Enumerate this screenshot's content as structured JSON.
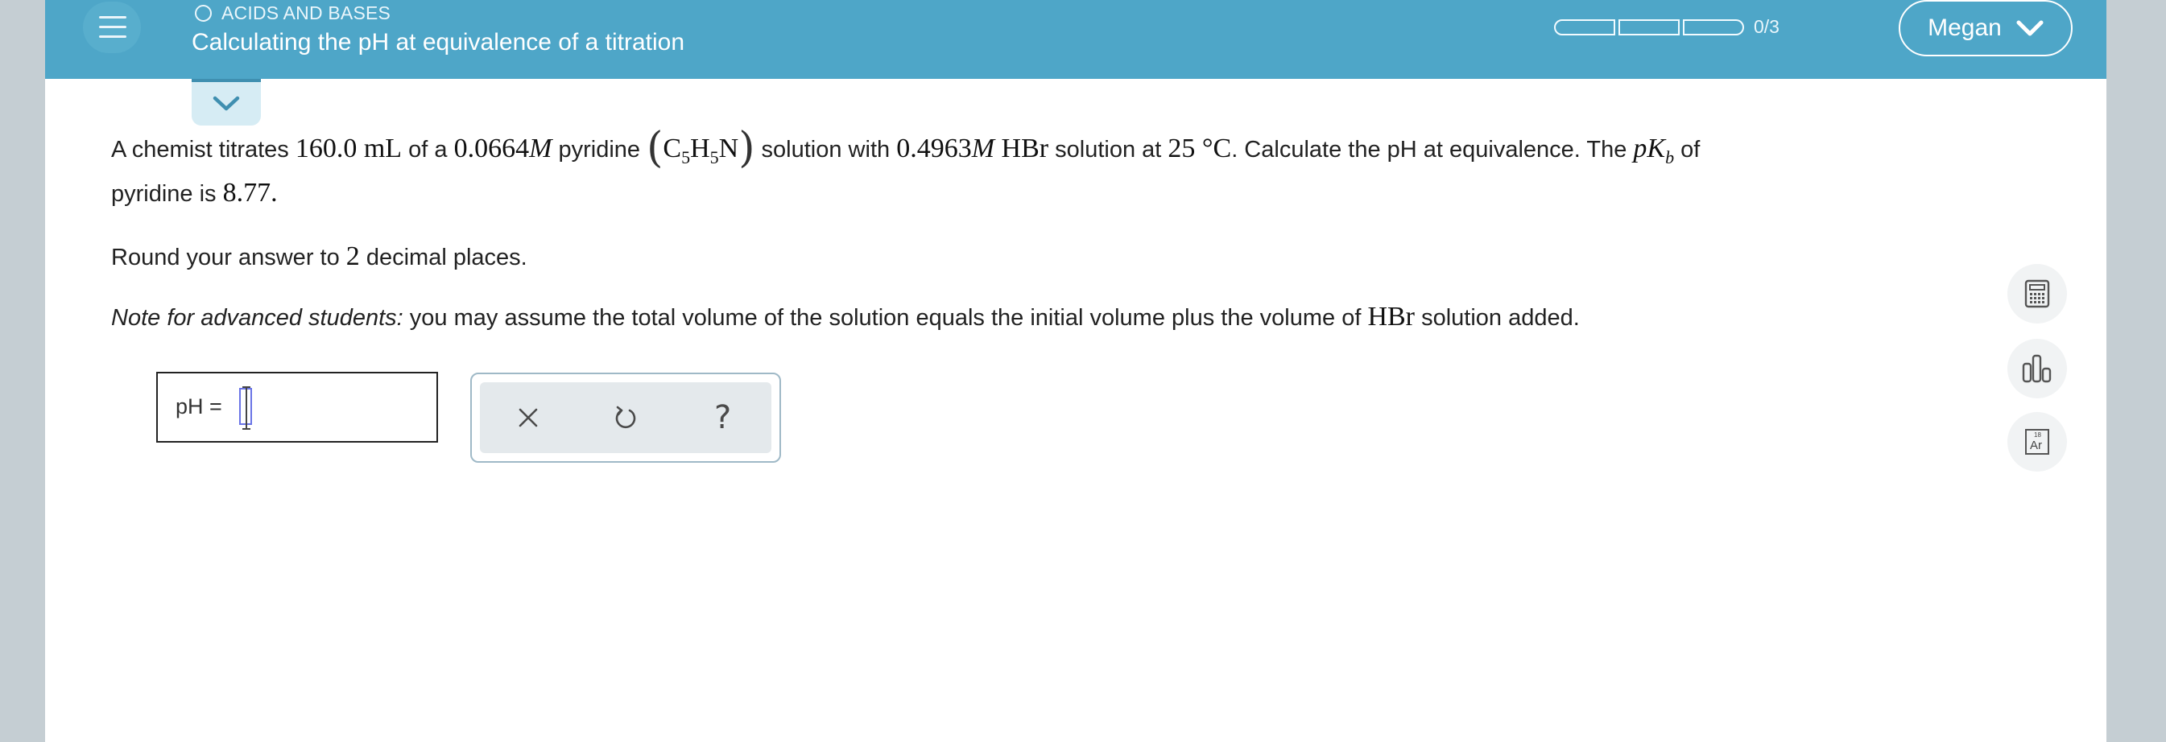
{
  "header": {
    "topic": "ACIDS AND BASES",
    "title": "Calculating the pH at equivalence of a titration",
    "progress_text": "0/3",
    "progress_completed": 0,
    "progress_total": 3,
    "user_name": "Megan"
  },
  "question": {
    "p1_a": "A chemist titrates ",
    "vol": "160.0 mL",
    "p1_b": " of a ",
    "conc1": "0.0664",
    "unit_M": "M",
    "p1_c": " pyridine ",
    "formula_C": "C",
    "formula_5a": "5",
    "formula_H": "H",
    "formula_5b": "5",
    "formula_N": "N",
    "p1_d": " solution with ",
    "conc2": "0.4963",
    "hbr": "HBr",
    "p1_e": " solution at ",
    "temp": "25 °C",
    "p1_f": ". Calculate the pH at equivalence. The ",
    "pk_p": "p",
    "pk_K": "K",
    "pk_b": "b",
    "p1_g": " of",
    "p1b_a": "pyridine is ",
    "pkb_value": "8.77",
    "p1b_b": ".",
    "p2_a": "Round your answer to ",
    "decimals": "2",
    "p2_b": " decimal places.",
    "note_label": "Note for advanced students:",
    "note_a": " you may assume the total volume of the solution equals the initial volume plus the volume of ",
    "note_hbr": "HBr",
    "note_b": " solution added."
  },
  "answer": {
    "label": "pH",
    "equals": "=",
    "value": ""
  },
  "tools": {
    "clear_icon": "x-icon",
    "undo_icon": "undo-icon",
    "help_icon": "question-icon",
    "help_glyph": "?"
  },
  "side_tools": {
    "periodic_table_text_top": "18",
    "periodic_table_text_main": "Ar"
  },
  "colors": {
    "header_bg": "#4ea6c8",
    "page_bg": "#ffffff",
    "side_bg": "#c5ced3",
    "cursor": "#6a74e6"
  }
}
